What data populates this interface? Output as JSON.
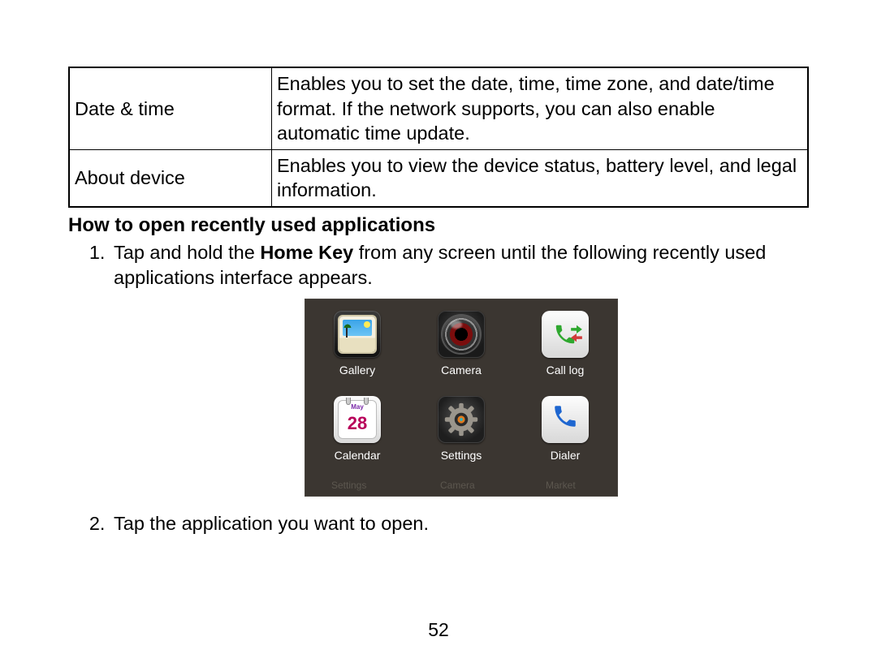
{
  "table": {
    "rows": [
      {
        "label": "Date & time",
        "desc": "Enables you to set the date, time, time zone, and date/time format. If the network supports, you can also enable automatic time update."
      },
      {
        "label": "About device",
        "desc": "Enables you to view the device status, battery level, and legal information."
      }
    ]
  },
  "heading": "How to open recently used applications",
  "steps": {
    "s1_a": "Tap and hold the ",
    "s1_bold": "Home Key",
    "s1_b": " from any screen until the following recently used applications interface appears.",
    "s2": "Tap the application you want to open."
  },
  "apps": {
    "gallery": "Gallery",
    "camera": "Camera",
    "calllog": "Call log",
    "calendar": "Calendar",
    "settings": "Settings",
    "dialer": "Dialer"
  },
  "calendar": {
    "month": "May",
    "day": "28"
  },
  "bg_labels": {
    "a": "Settings",
    "b": "Camera",
    "c": "Market"
  },
  "page_number": "52"
}
